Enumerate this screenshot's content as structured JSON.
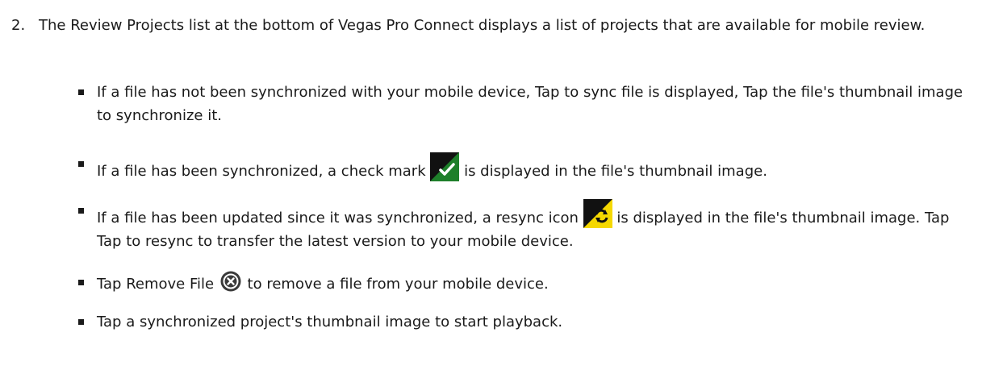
{
  "step": {
    "number": "2.",
    "text": "The Review Projects list at the bottom of Vegas Pro Connect displays a list of projects that are available for mobile review."
  },
  "bullets": {
    "b1": {
      "text": "If a file has not been synchronized with your mobile device, Tap to sync file is displayed, Tap the file's thumbnail image to synchronize it."
    },
    "b2": {
      "before": "If a file has been synchronized, a check mark ",
      "after": " is displayed in the file's thumbnail image.",
      "icon": "check-mark-icon",
      "icon_colors": {
        "bg": "#1e7f2a",
        "corner": "#111111",
        "glyph": "#ffffff"
      }
    },
    "b3": {
      "before": "If a file has been updated since it was synchronized, a resync icon ",
      "after": " is displayed in the file's thumbnail image. Tap Tap to resync to transfer the latest version to your mobile device.",
      "icon": "resync-icon",
      "icon_colors": {
        "bg": "#f5d800",
        "corner": "#111111",
        "glyph": "#111111"
      }
    },
    "b4": {
      "before": "Tap Remove File ",
      "after": " to remove a file from your mobile device.",
      "icon": "remove-file-icon",
      "icon_colors": {
        "circle": "#3a3a3a",
        "glyph": "#ffffff"
      }
    },
    "b5": {
      "text": "Tap a synchronized project's thumbnail image to start playback."
    }
  }
}
